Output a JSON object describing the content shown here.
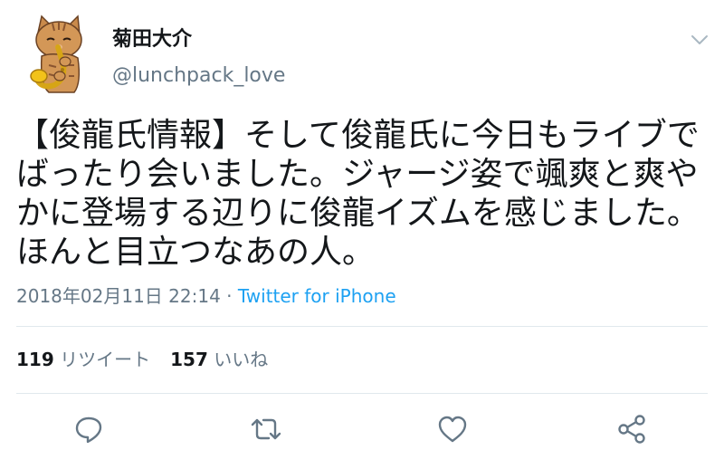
{
  "tweet": {
    "display_name": "菊田大介",
    "handle": "@lunchpack_love",
    "text": "【俊龍氏情報】そして俊龍氏に今日もライブでばったり会いました。ジャージ姿で颯爽と爽やかに登場する辺りに俊龍イズムを感じました。ほんと目立つなあの人。",
    "timestamp": "2018年02月11日 22:14",
    "separator": " · ",
    "source": "Twitter for iPhone"
  },
  "stats": {
    "retweets_count": "119",
    "retweets_label": "リツイート",
    "likes_count": "157",
    "likes_label": "いいね"
  },
  "icons": {
    "avatar": "cat-saxophone-avatar",
    "menu": "chevron-down-icon",
    "reply": "reply-icon",
    "retweet": "retweet-icon",
    "like": "heart-icon",
    "share": "share-icon"
  },
  "colors": {
    "text": "#14171a",
    "secondary": "#657786",
    "link": "#1da1f2",
    "divider": "#e1e8ed",
    "icon": "#657786"
  }
}
